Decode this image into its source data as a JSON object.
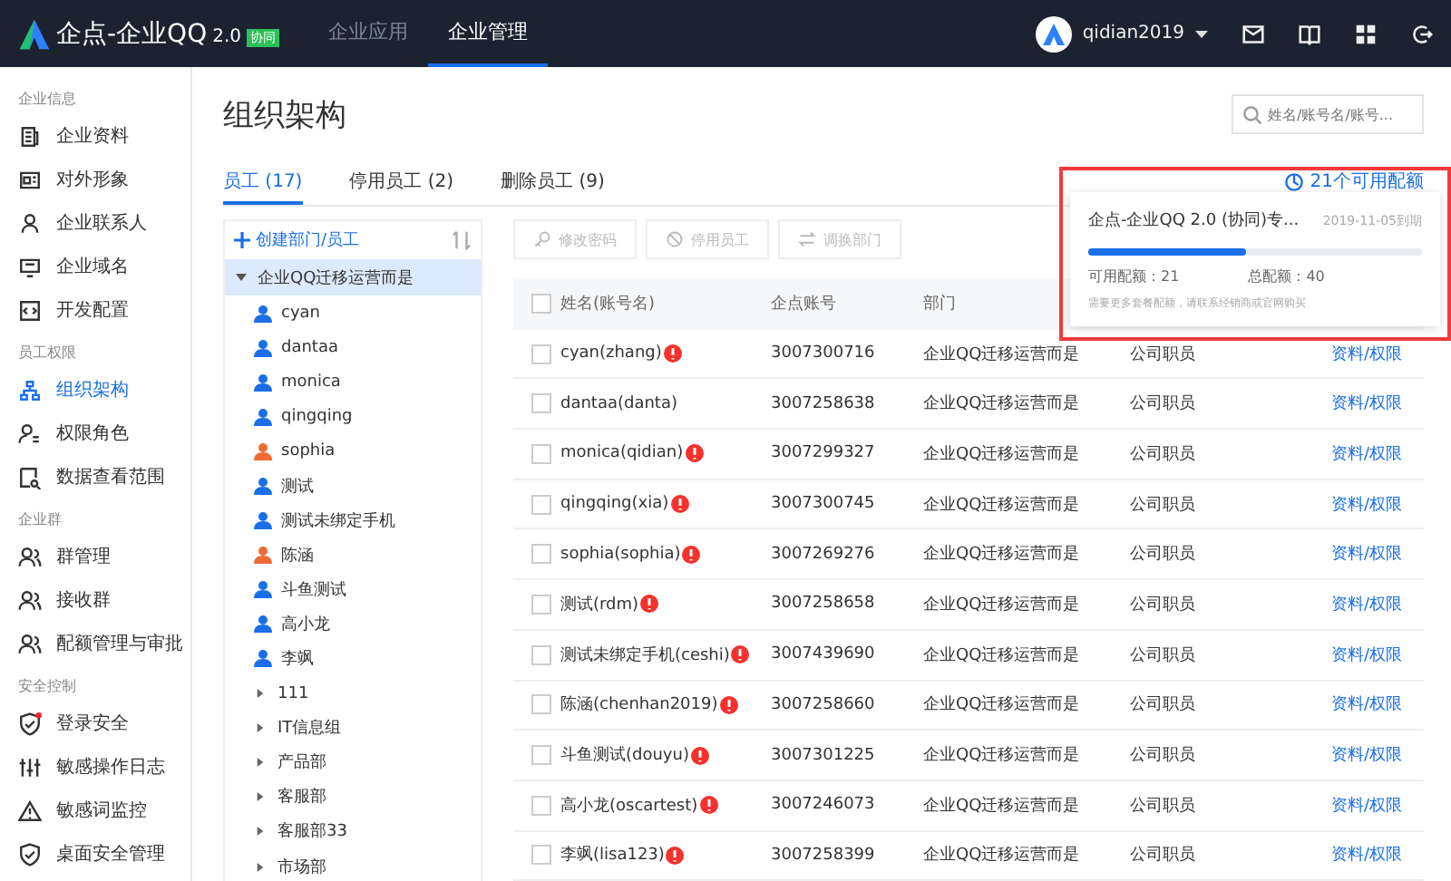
{
  "topbar": {
    "logo_text": "企点-企业QQ",
    "logo_version": "2.0",
    "logo_badge": "协同",
    "nav": [
      {
        "label": "企业应用",
        "selected": false
      },
      {
        "label": "企业管理",
        "selected": true
      }
    ],
    "user": "qidian2019"
  },
  "sidebar": [
    {
      "heading": "企业信息",
      "items": [
        {
          "label": "企业资料",
          "selected": false,
          "alert": false
        },
        {
          "label": "对外形象",
          "selected": false,
          "alert": false
        },
        {
          "label": "企业联系人",
          "selected": false,
          "alert": false
        },
        {
          "label": "企业域名",
          "selected": false,
          "alert": false
        },
        {
          "label": "开发配置",
          "selected": false,
          "alert": false
        }
      ]
    },
    {
      "heading": "员工权限",
      "items": [
        {
          "label": "组织架构",
          "selected": true,
          "alert": false
        },
        {
          "label": "权限角色",
          "selected": false,
          "alert": false
        },
        {
          "label": "数据查看范围",
          "selected": false,
          "alert": false
        }
      ]
    },
    {
      "heading": "企业群",
      "items": [
        {
          "label": "群管理",
          "selected": false,
          "alert": false
        },
        {
          "label": "接收群",
          "selected": false,
          "alert": false
        },
        {
          "label": "配额管理与审批",
          "selected": false,
          "alert": false
        }
      ]
    },
    {
      "heading": "安全控制",
      "items": [
        {
          "label": "登录安全",
          "selected": false,
          "alert": true
        },
        {
          "label": "敏感操作日志",
          "selected": false,
          "alert": false
        },
        {
          "label": "敏感词监控",
          "selected": false,
          "alert": false
        },
        {
          "label": "桌面安全管理",
          "selected": false,
          "alert": false
        }
      ]
    }
  ],
  "page_title": "组织架构",
  "search": {
    "placeholder": "姓名/账号名/账号..."
  },
  "tabs": [
    {
      "label": "员工 (17)",
      "selected": true
    },
    {
      "label": "停用员工 (2)",
      "selected": false
    },
    {
      "label": "删除员工 (9)",
      "selected": false
    }
  ],
  "quota_link": "21个可用配额",
  "tree": {
    "create_label": "创建部门/员工",
    "root": {
      "label": "企业QQ迁移运营而是",
      "expanded": true,
      "selected": true,
      "children": [
        {
          "kind": "person",
          "label": "cyan",
          "color": "#1a6fe8"
        },
        {
          "kind": "person",
          "label": "dantaa",
          "color": "#1a6fe8"
        },
        {
          "kind": "person",
          "label": "monica",
          "color": "#1a6fe8"
        },
        {
          "kind": "person",
          "label": "qingqing",
          "color": "#1a6fe8"
        },
        {
          "kind": "person",
          "label": "sophia",
          "color": "#f06a35"
        },
        {
          "kind": "person",
          "label": "测试",
          "color": "#1a6fe8"
        },
        {
          "kind": "person",
          "label": "测试未绑定手机",
          "color": "#1a6fe8"
        },
        {
          "kind": "person",
          "label": "陈涵",
          "color": "#f06a35"
        },
        {
          "kind": "person",
          "label": "斗鱼测试",
          "color": "#1a6fe8"
        },
        {
          "kind": "person",
          "label": "高小龙",
          "color": "#1a6fe8"
        },
        {
          "kind": "person",
          "label": "李飒",
          "color": "#1a6fe8"
        },
        {
          "kind": "dept",
          "label": "111",
          "expanded": false
        },
        {
          "kind": "dept",
          "label": "IT信息组",
          "expanded": false
        },
        {
          "kind": "dept",
          "label": "产品部",
          "expanded": false
        },
        {
          "kind": "dept",
          "label": "客服部",
          "expanded": false
        },
        {
          "kind": "dept",
          "label": "客服部33",
          "expanded": false
        },
        {
          "kind": "dept",
          "label": "市场部",
          "expanded": false
        }
      ]
    }
  },
  "toolbar": [
    {
      "label": "修改密码",
      "disabled": true
    },
    {
      "label": "停用员工",
      "disabled": true
    },
    {
      "label": "调换部门",
      "disabled": true
    }
  ],
  "table": {
    "columns": [
      "姓名(账号名)",
      "企点账号",
      "部门"
    ],
    "header_checked": false,
    "rows": [
      {
        "name": "cyan(zhang)",
        "alert": true,
        "account": "3007300716",
        "dept": "企业QQ迁移运营而是",
        "role": "公司职员",
        "action": "资料/权限",
        "checked": false
      },
      {
        "name": "dantaa(danta)",
        "alert": false,
        "account": "3007258638",
        "dept": "企业QQ迁移运营而是",
        "role": "公司职员",
        "action": "资料/权限",
        "checked": false
      },
      {
        "name": "monica(qidian)",
        "alert": true,
        "account": "3007299327",
        "dept": "企业QQ迁移运营而是",
        "role": "公司职员",
        "action": "资料/权限",
        "checked": false
      },
      {
        "name": "qingqing(xia)",
        "alert": true,
        "account": "3007300745",
        "dept": "企业QQ迁移运营而是",
        "role": "公司职员",
        "action": "资料/权限",
        "checked": false
      },
      {
        "name": "sophia(sophia)",
        "alert": true,
        "account": "3007269276",
        "dept": "企业QQ迁移运营而是",
        "role": "公司职员",
        "action": "资料/权限",
        "checked": false
      },
      {
        "name": "测试(rdm)",
        "alert": true,
        "account": "3007258658",
        "dept": "企业QQ迁移运营而是",
        "role": "公司职员",
        "action": "资料/权限",
        "checked": false
      },
      {
        "name": "测试未绑定手机(ceshi)",
        "alert": true,
        "account": "3007439690",
        "dept": "企业QQ迁移运营而是",
        "role": "公司职员",
        "action": "资料/权限",
        "checked": false
      },
      {
        "name": "陈涵(chenhan2019)",
        "alert": true,
        "account": "3007258660",
        "dept": "企业QQ迁移运营而是",
        "role": "公司职员",
        "action": "资料/权限",
        "checked": false
      },
      {
        "name": "斗鱼测试(douyu)",
        "alert": true,
        "account": "3007301225",
        "dept": "企业QQ迁移运营而是",
        "role": "公司职员",
        "action": "资料/权限",
        "checked": false
      },
      {
        "name": "高小龙(oscartest)",
        "alert": true,
        "account": "3007246073",
        "dept": "企业QQ迁移运营而是",
        "role": "公司职员",
        "action": "资料/权限",
        "checked": false
      },
      {
        "name": "李飒(lisa123)",
        "alert": true,
        "account": "3007258399",
        "dept": "企业QQ迁移运营而是",
        "role": "公司职员",
        "action": "资料/权限",
        "checked": false
      }
    ]
  },
  "quota_popup": {
    "title": "企点-企业QQ 2.0 (协同)专...",
    "expiry": "2019-11-05到期",
    "level": 0.475,
    "available": "可用配额：21",
    "total": "总配额：40",
    "note": "需要更多套餐配额，请联系经销商或官网购买",
    "highlighted": true
  }
}
